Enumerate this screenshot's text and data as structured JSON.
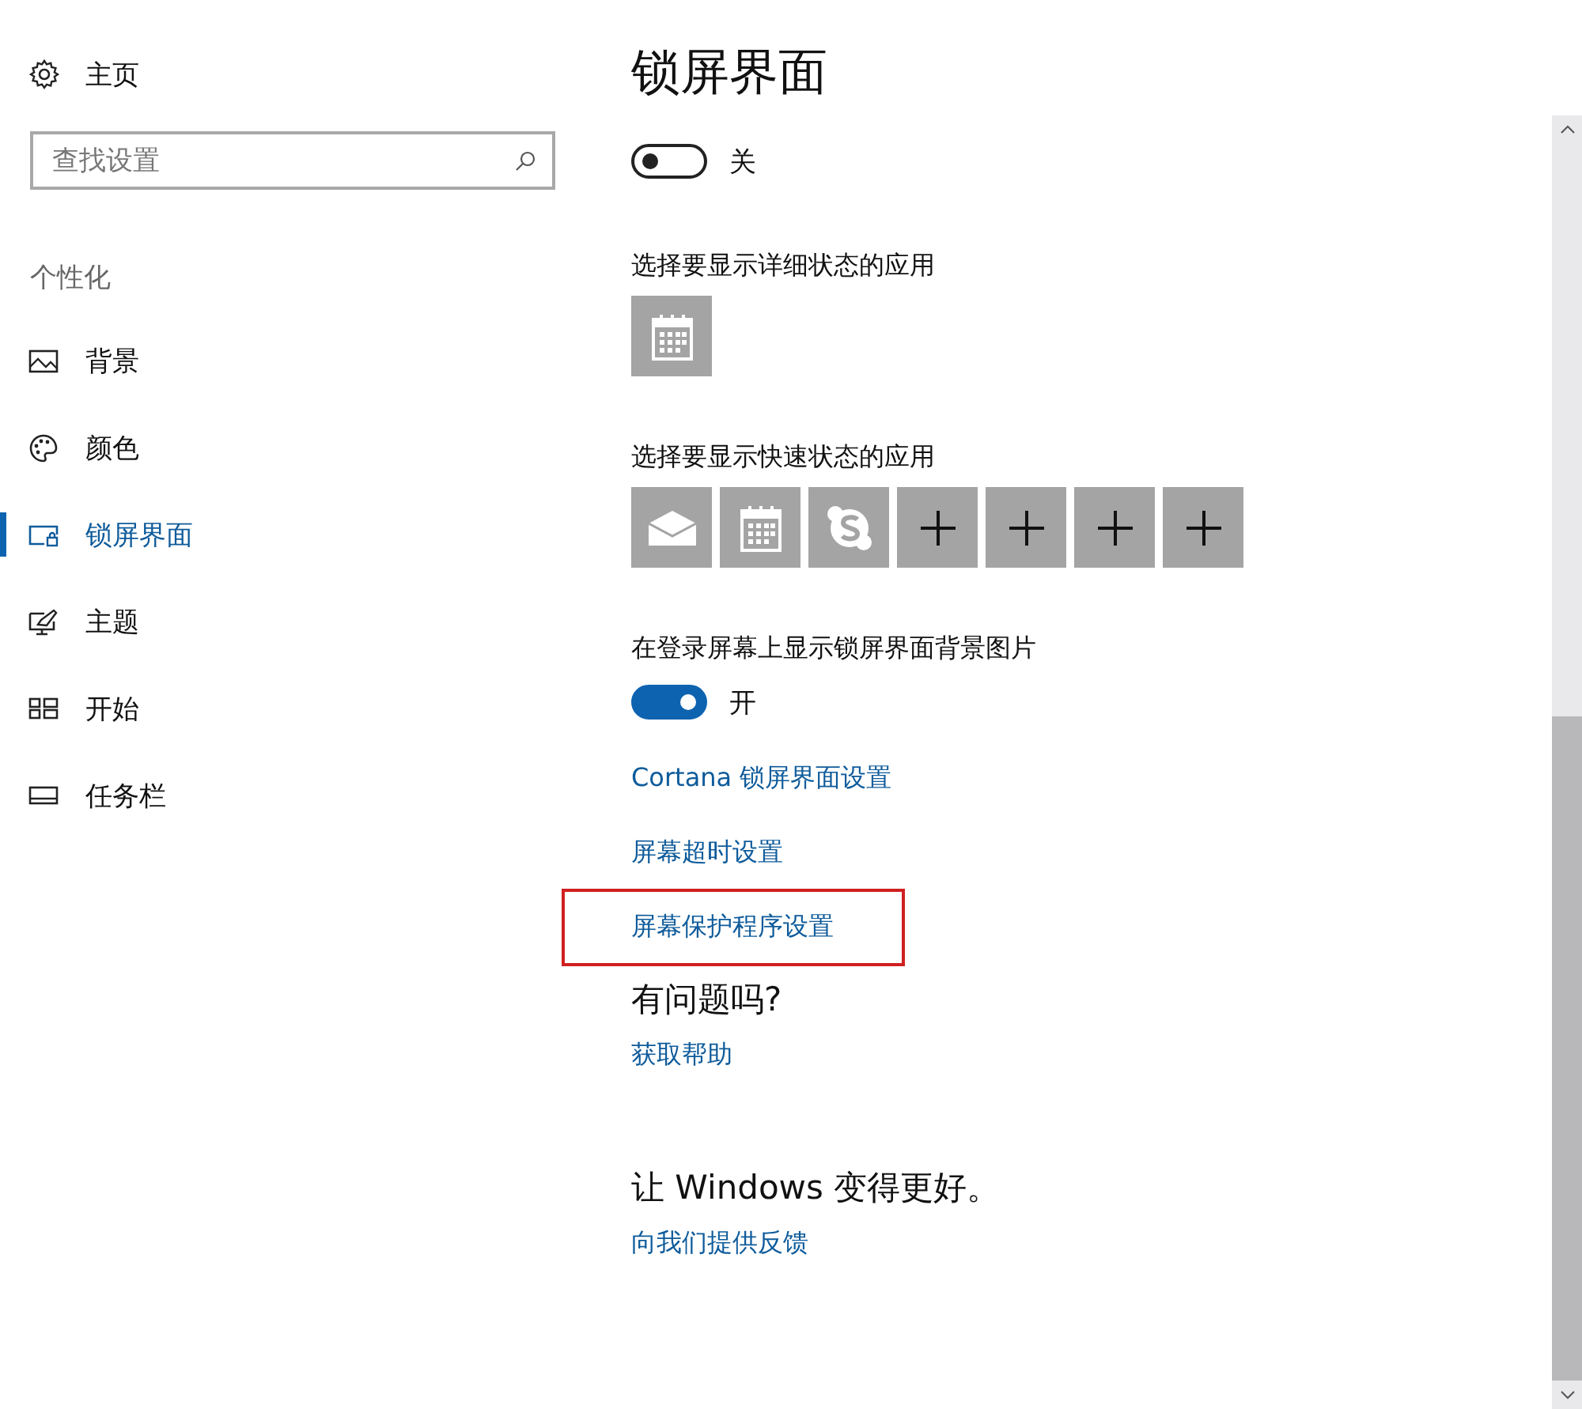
{
  "sidebar": {
    "home": "主页",
    "search": {
      "placeholder": "查找设置"
    },
    "section": "个性化",
    "items": [
      {
        "label": "背景",
        "kind": "picture",
        "selected": false
      },
      {
        "label": "颜色",
        "kind": "palette",
        "selected": false
      },
      {
        "label": "锁屏界面",
        "kind": "lockscreen",
        "selected": true
      },
      {
        "label": "主题",
        "kind": "theme",
        "selected": false
      },
      {
        "label": "开始",
        "kind": "start",
        "selected": false
      },
      {
        "label": "任务栏",
        "kind": "taskbar",
        "selected": false
      }
    ]
  },
  "page": {
    "title": "锁屏界面",
    "blocks": [
      {
        "kind": "toggle",
        "on": false,
        "state": "关"
      },
      {
        "kind": "label",
        "text": "选择要显示详细状态的应用"
      },
      {
        "kind": "tiles",
        "tiles": [
          {
            "kind": "calendar"
          }
        ]
      },
      {
        "kind": "label",
        "text": "选择要显示快速状态的应用"
      },
      {
        "kind": "tiles",
        "tiles": [
          {
            "kind": "mail"
          },
          {
            "kind": "calendar"
          },
          {
            "kind": "skype"
          },
          {
            "kind": "add"
          },
          {
            "kind": "add"
          },
          {
            "kind": "add"
          },
          {
            "kind": "add"
          }
        ]
      },
      {
        "kind": "label",
        "text": "在登录屏幕上显示锁屏界面背景图片"
      },
      {
        "kind": "toggle",
        "on": true,
        "state": "开"
      },
      {
        "kind": "link",
        "text": "Cortana 锁屏界面设置",
        "highlighted": false
      },
      {
        "kind": "link",
        "text": "屏幕超时设置",
        "highlighted": false
      },
      {
        "kind": "link",
        "text": "屏幕保护程序设置",
        "highlighted": true
      },
      {
        "kind": "heading",
        "text": "有问题吗?"
      },
      {
        "kind": "link",
        "text": "获取帮助",
        "highlighted": false
      },
      {
        "kind": "heading",
        "text": "让 Windows 变得更好。"
      },
      {
        "kind": "link",
        "text": "向我们提供反馈",
        "highlighted": false
      }
    ]
  }
}
